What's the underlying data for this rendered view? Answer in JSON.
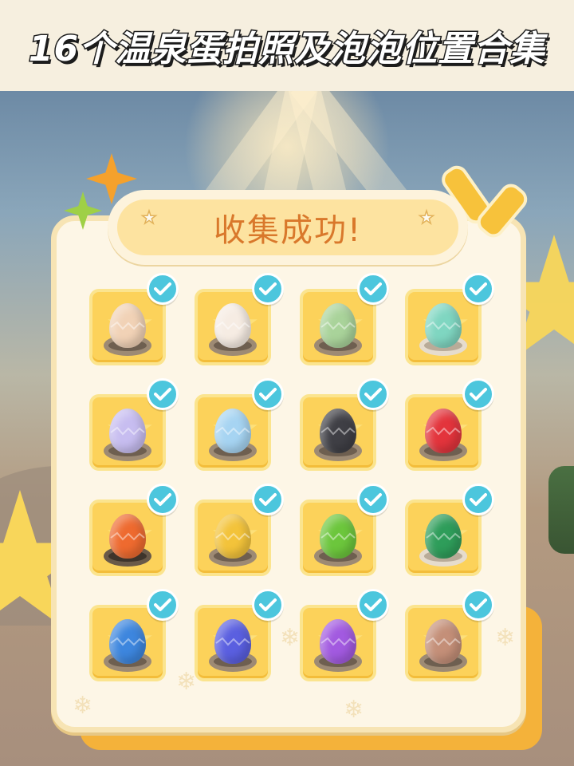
{
  "banner": {
    "title": "16个温泉蛋拍照及泡泡位置合集"
  },
  "panel": {
    "title": "收集成功!"
  },
  "icons": {
    "title_star": "star-icon",
    "checkmark": "checkmark-icon",
    "sparkle": "sparkle-icon"
  },
  "colors": {
    "banner_bg": "#f6efdf",
    "panel_bg": "#fdf6e6",
    "header_text": "#d9782b",
    "slot_bg": "#fcd25a",
    "check_bg": "#4cc6dd"
  },
  "collection": {
    "total": 16,
    "collected": 16,
    "eggs": [
      {
        "color": "#f1d2b6",
        "nest": "normal",
        "collected": true
      },
      {
        "color": "#f6ece3",
        "nest": "normal",
        "collected": true
      },
      {
        "color": "#a9d39a",
        "nest": "normal",
        "collected": true
      },
      {
        "color": "#7fd6c1",
        "nest": "light",
        "collected": true
      },
      {
        "color": "#c7bdf0",
        "nest": "normal",
        "collected": true
      },
      {
        "color": "#a6d4f2",
        "nest": "normal",
        "collected": true
      },
      {
        "color": "#3f3f45",
        "nest": "normal",
        "collected": true
      },
      {
        "color": "#e3343c",
        "nest": "normal",
        "collected": true
      },
      {
        "color": "#ee6a2f",
        "nest": "dark",
        "collected": true
      },
      {
        "color": "#f3c33a",
        "nest": "normal",
        "collected": true
      },
      {
        "color": "#6cc63c",
        "nest": "normal",
        "collected": true
      },
      {
        "color": "#2e9d5a",
        "nest": "light",
        "collected": true
      },
      {
        "color": "#3d86de",
        "nest": "normal",
        "collected": true
      },
      {
        "color": "#5a5fe0",
        "nest": "normal",
        "collected": true
      },
      {
        "color": "#a25ae0",
        "nest": "normal",
        "collected": true
      },
      {
        "color": "#c48f78",
        "nest": "normal",
        "collected": true
      }
    ]
  }
}
